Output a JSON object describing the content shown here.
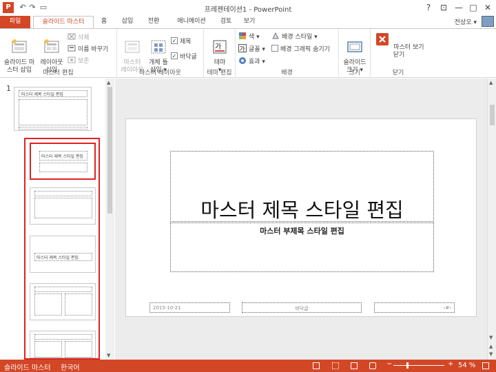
{
  "titlebar": {
    "title": "프레젠테이션1 - PowerPoint",
    "logo": "P",
    "help": "?",
    "ribbon_display": "⊡",
    "minimize": "—",
    "maximize": "□",
    "close": "✕",
    "qa_undo": "↶",
    "qa_redo": "↷",
    "qa_presenter": "▭"
  },
  "tabs": [
    {
      "label": "파일"
    },
    {
      "label": "슬라이드 마스터"
    },
    {
      "label": "홈"
    },
    {
      "label": "삽입"
    },
    {
      "label": "전환"
    },
    {
      "label": "애니메이션"
    },
    {
      "label": "검토"
    },
    {
      "label": "보기"
    }
  ],
  "user": {
    "name": "전상오 ▾"
  },
  "ribbon": {
    "groups": {
      "master_edit": "마스터 편집",
      "master_layout": "마스터 레이아웃",
      "theme_edit": "테마 편집",
      "background": "배경",
      "size": "크기",
      "close": "닫기"
    },
    "insert_master": "슬라이드 마\n스터 삽입",
    "insert_layout": "레이아웃\n삽입",
    "delete": "삭제",
    "rename": "이름 바꾸기",
    "preserve": "보존",
    "master_layout_btn": "마스터\n레이아웃",
    "insert_placeholder": "개체 틀\n삽입 ▾",
    "title_chk": "제목",
    "footer_chk": "바닥글",
    "theme": "테마\n▾",
    "colors": "색 ▾",
    "fonts": "글꼴 ▾",
    "effects": "효과 ▾",
    "bg_styles": "배경 스타일 ▾",
    "hide_bg": "배경 그래픽 숨기기",
    "slide_size": "슬라이드\n크기 ▾",
    "close_master": "마스터 보기 닫기"
  },
  "thumbs": {
    "slide_number": "1",
    "master_title": "마스터 제목 스타일 편집",
    "layout_title": "마스터 제목 스타일 편집",
    "small_title": "마스터 제목 스타일 편집"
  },
  "slide": {
    "title": "마스터 제목 스타일 편집",
    "subtitle": "마스터 부제목 스타일 편집",
    "date": "2015-10-21",
    "footer": "바닥글",
    "page": "‹#›"
  },
  "status": {
    "mode": "슬라이드 마스터",
    "language": "한국어",
    "zoom": "54 %",
    "zoom_minus": "−",
    "zoom_plus": "+",
    "zoom_level": 0.54
  },
  "colors": {
    "accent": "#d24726"
  }
}
